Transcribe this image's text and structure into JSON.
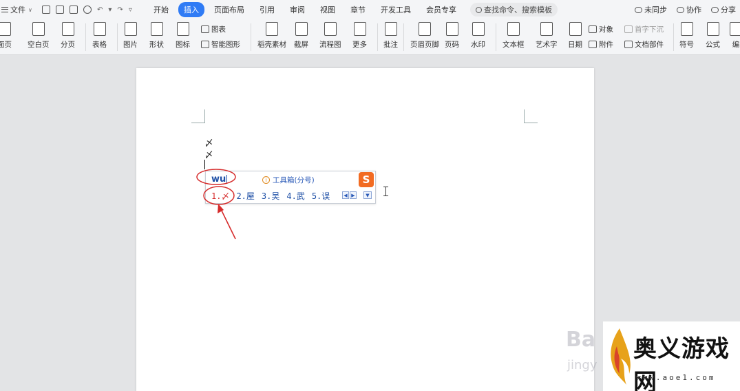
{
  "menubar": {
    "file_label": "文件",
    "tabs": [
      {
        "label": "开始",
        "active": false
      },
      {
        "label": "插入",
        "active": true
      },
      {
        "label": "页面布局",
        "active": false
      },
      {
        "label": "引用",
        "active": false
      },
      {
        "label": "审阅",
        "active": false
      },
      {
        "label": "视图",
        "active": false
      },
      {
        "label": "章节",
        "active": false
      },
      {
        "label": "开发工具",
        "active": false
      },
      {
        "label": "会员专享",
        "active": false
      }
    ],
    "search_label": "查找命令、搜索模板",
    "sync_label": "未同步",
    "collab_label": "协作",
    "share_label": "分享"
  },
  "ribbon": {
    "items": [
      {
        "label": "面页",
        "icon": "cover-page-icon"
      },
      {
        "label": "空白页",
        "icon": "blank-page-icon"
      },
      {
        "label": "分页",
        "icon": "page-break-icon"
      },
      {
        "label": "表格",
        "icon": "table-icon"
      },
      {
        "label": "图片",
        "icon": "picture-icon"
      },
      {
        "label": "形状",
        "icon": "shape-icon"
      },
      {
        "label": "图标",
        "icon": "icons-icon"
      },
      {
        "label": "稻壳素材",
        "icon": "docer-material-icon"
      },
      {
        "label": "截屏",
        "icon": "screenshot-icon"
      },
      {
        "label": "流程图",
        "icon": "flowchart-icon"
      },
      {
        "label": "更多",
        "icon": "more-icon"
      },
      {
        "label": "批注",
        "icon": "comment-icon"
      },
      {
        "label": "页眉页脚",
        "icon": "header-footer-icon"
      },
      {
        "label": "页码",
        "icon": "page-number-icon"
      },
      {
        "label": "水印",
        "icon": "watermark-icon"
      },
      {
        "label": "文本框",
        "icon": "textbox-icon"
      },
      {
        "label": "艺术字",
        "icon": "wordart-icon"
      },
      {
        "label": "日期",
        "icon": "date-icon"
      },
      {
        "label": "符号",
        "icon": "symbol-icon"
      },
      {
        "label": "公式",
        "icon": "formula-icon"
      },
      {
        "label": "编",
        "icon": "edit-icon"
      }
    ],
    "small_items": {
      "chart": "图表",
      "smart_shape": "智能图形",
      "object": "对象",
      "drop_cap": "首字下沉",
      "attachment": "附件",
      "doc_parts": "文档部件"
    }
  },
  "document": {
    "lines": [
      "〆",
      "〆"
    ]
  },
  "ime": {
    "input": "wu",
    "toolbox": "工具箱(分号)",
    "candidates": [
      "1.〆",
      "2.屋",
      "3.吴",
      "4.武",
      "5.误"
    ],
    "selected_index": 0,
    "logo": "S"
  },
  "watermarks": {
    "baidu": "Ba",
    "baidu_sub": "jingy",
    "site_name": "奥义游戏网",
    "site_url": "www.aoe1.com"
  },
  "colors": {
    "accent": "#2f7bf5",
    "annotation": "#d62c2c",
    "ime_text": "#1e4fa6",
    "ime_logo": "#f26b22"
  }
}
